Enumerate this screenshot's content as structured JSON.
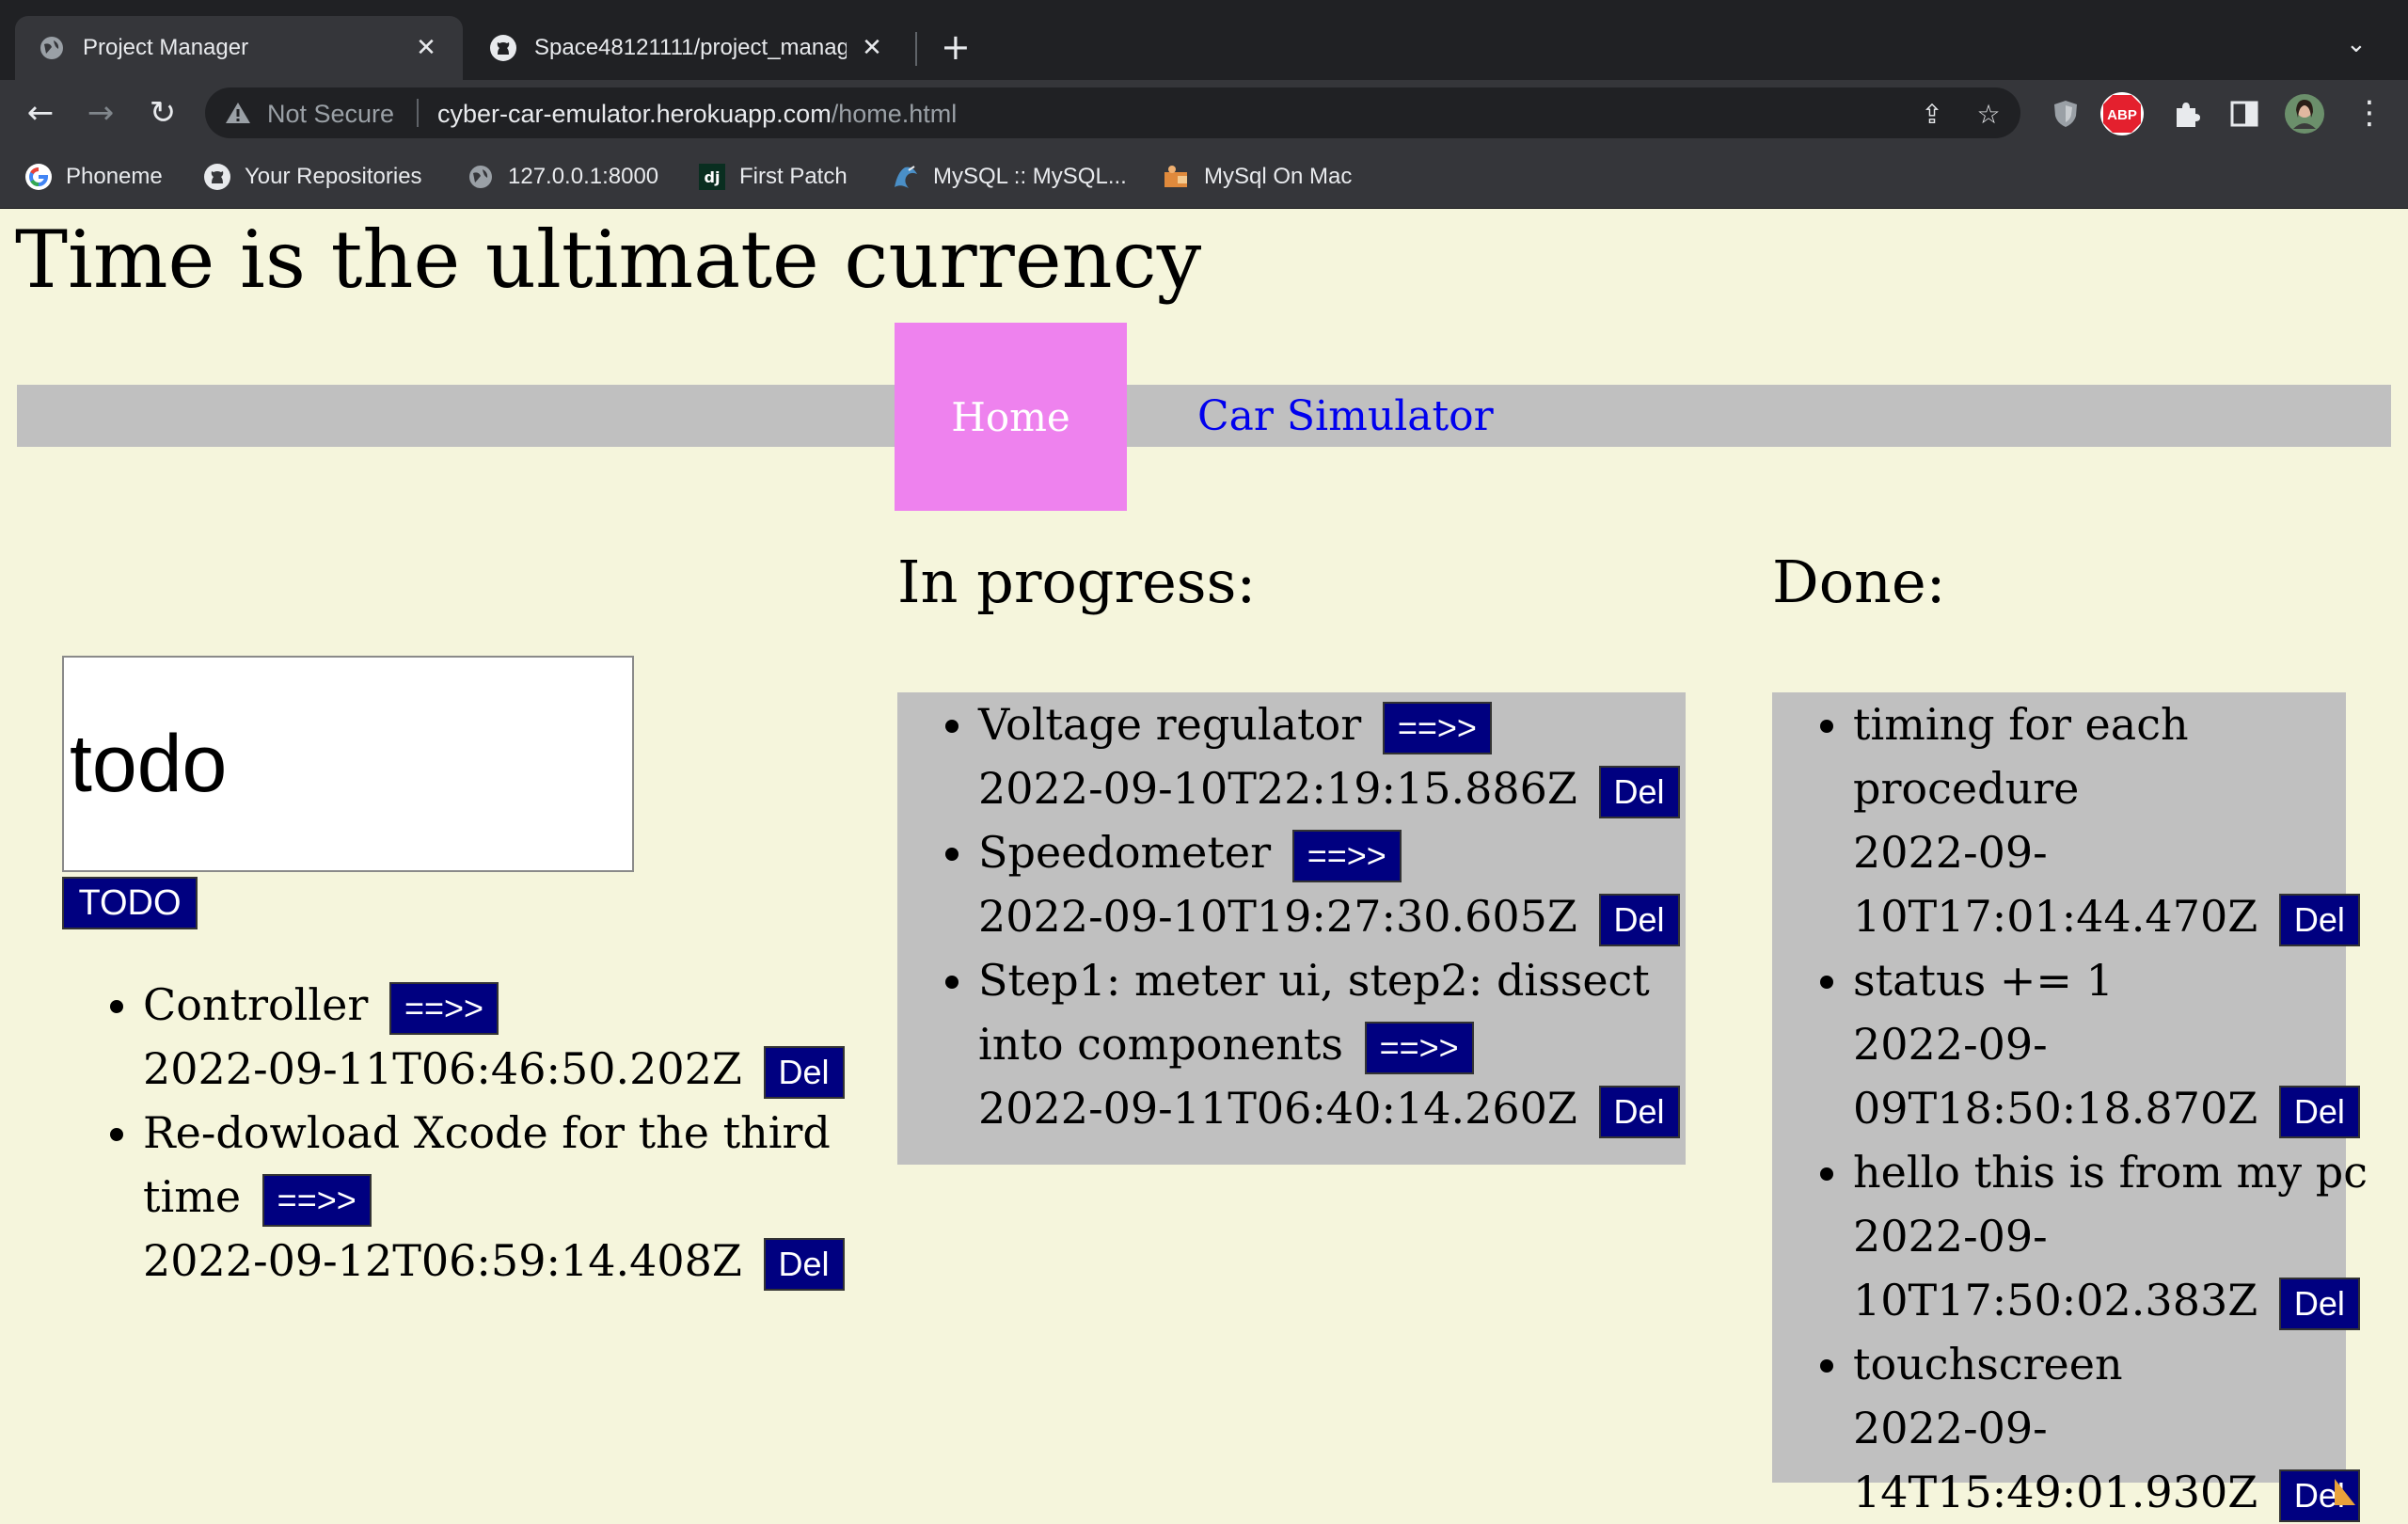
{
  "browser": {
    "tabs": [
      {
        "title": "Project Manager",
        "active": true,
        "icon": "globe-icon"
      },
      {
        "title": "Space48121111/project_manag",
        "active": false,
        "icon": "github-icon"
      }
    ],
    "address": {
      "security_label": "Not Secure",
      "host": "cyber-car-emulator.herokuapp.com",
      "path": "/home.html"
    },
    "bookmarks": [
      {
        "label": "Phoneme",
        "icon": "google-icon"
      },
      {
        "label": "Your Repositories",
        "icon": "github-icon"
      },
      {
        "label": "127.0.0.1:8000",
        "icon": "globe-icon"
      },
      {
        "label": "First Patch",
        "icon": "django-icon"
      },
      {
        "label": "MySQL :: MySQL...",
        "icon": "mysql-icon"
      },
      {
        "label": "MySql On Mac",
        "icon": "mysql-folder-icon"
      }
    ],
    "extensions": {
      "abp": "ABP"
    }
  },
  "page": {
    "heading": "Time is the ultimate currency",
    "nav": {
      "home": "Home",
      "car": "Car Simulator"
    },
    "todo": {
      "input_value": "todo",
      "button_label": "TODO",
      "items": [
        {
          "text": "Controller",
          "move": "==>>",
          "timestamp": "2022-09-11T06:46:50.202Z",
          "del": "Del"
        },
        {
          "text": "Re-dowload Xcode for the third time",
          "move": "==>>",
          "timestamp": "2022-09-12T06:59:14.408Z",
          "del": "Del"
        }
      ]
    },
    "in_progress": {
      "title": "In progress:",
      "items": [
        {
          "text": "Voltage regulator",
          "move": "==>>",
          "timestamp": "2022-09-10T22:19:15.886Z",
          "del": "Del"
        },
        {
          "text": "Speedometer",
          "move": "==>>",
          "timestamp": "2022-09-10T19:27:30.605Z",
          "del": "Del"
        },
        {
          "text": "Step1: meter ui, step2: dissect into components",
          "move": "==>>",
          "timestamp": "2022-09-11T06:40:14.260Z",
          "del": "Del"
        }
      ]
    },
    "done": {
      "title": "Done:",
      "items": [
        {
          "text": "timing for each procedure",
          "timestamp": "2022-09-10T17:01:44.470Z",
          "del": "Del"
        },
        {
          "text": "status += 1",
          "timestamp": "2022-09-09T18:50:18.870Z",
          "del": "Del"
        },
        {
          "text": "hello this is from my pc",
          "timestamp": "2022-09-10T17:50:02.383Z",
          "del": "Del"
        },
        {
          "text": "touchscreen",
          "timestamp": "2022-09-14T15:49:01.930Z",
          "del": "Del"
        }
      ]
    }
  }
}
